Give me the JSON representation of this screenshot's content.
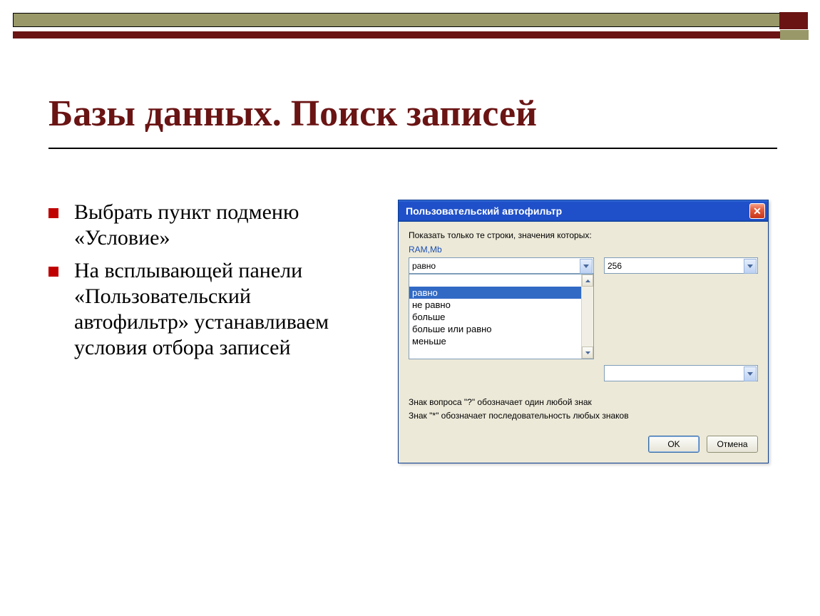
{
  "slide": {
    "title": "Базы данных. Поиск записей",
    "bullets": [
      "Выбрать пункт подменю «Условие»",
      "На всплывающей панели «Пользовательский автофильтр» устанавливаем условия отбора записей"
    ]
  },
  "dialog": {
    "title": "Пользовательский автофильтр",
    "instruction": "Показать только те строки, значения которых:",
    "field_label": "RAM,Mb",
    "operator_value": "равно",
    "operator_options": [
      "равно",
      "не равно",
      "больше",
      "больше или равно",
      "меньше"
    ],
    "criteria_value": "256",
    "criteria_value2": "",
    "hint1": "Знак вопроса \"?\" обозначает один любой знак",
    "hint2": "Знак \"*\" обозначает последовательность любых знаков",
    "ok_label": "OK",
    "cancel_label": "Отмена"
  }
}
